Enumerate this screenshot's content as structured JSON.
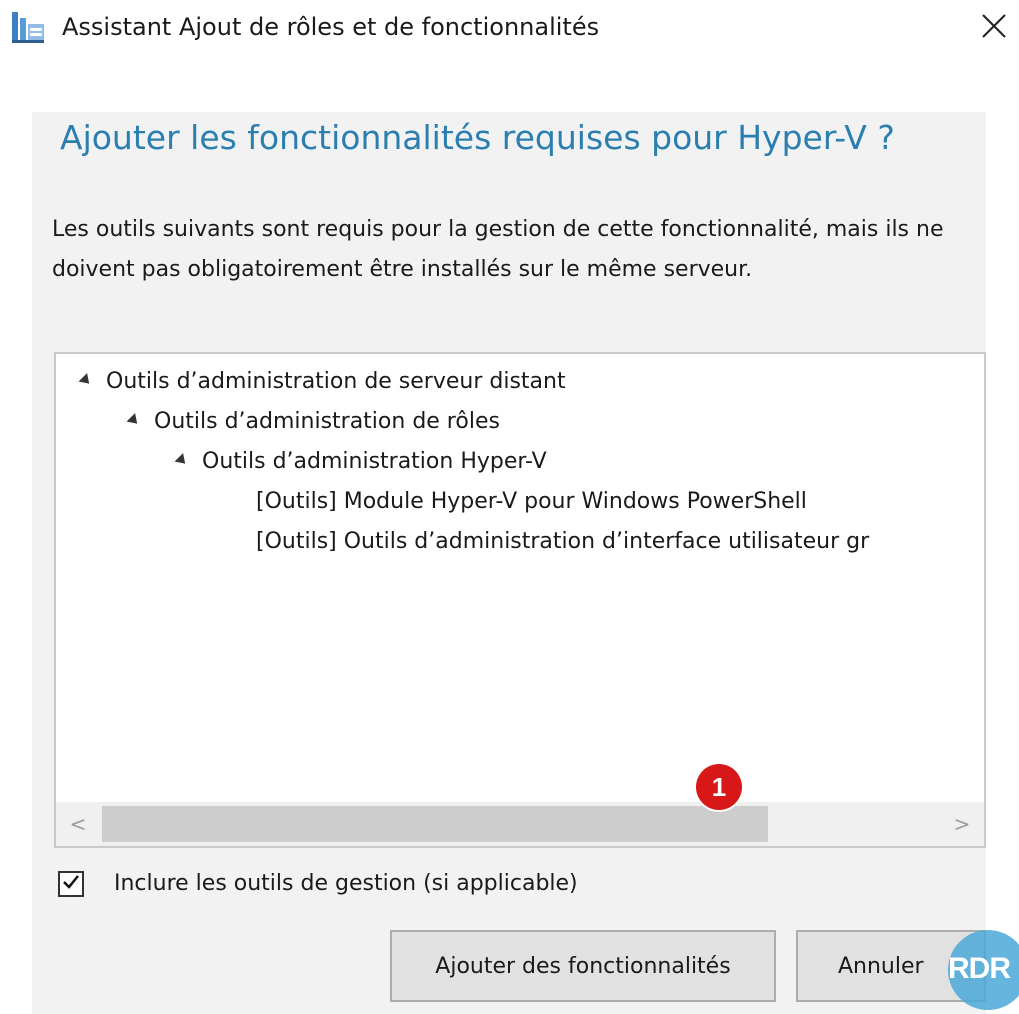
{
  "window": {
    "title": "Assistant Ajout de rôles et de fonctionnalités",
    "close_icon": "close-icon",
    "app_icon": "server-manager-icon"
  },
  "dialog": {
    "heading": "Ajouter les fonctionnalités requises pour Hyper-V ?",
    "description": "Les outils suivants sont requis pour la gestion de cette fonctionnalité, mais ils ne doivent pas obligatoirement être installés sur le même serveur."
  },
  "tree": {
    "items": [
      {
        "label": "Outils d’administration de serveur distant",
        "level": 0,
        "expanded": true
      },
      {
        "label": "Outils d’administration de rôles",
        "level": 1,
        "expanded": true
      },
      {
        "label": "Outils d’administration Hyper-V",
        "level": 2,
        "expanded": true
      },
      {
        "label": "[Outils] Module Hyper-V pour Windows PowerShell",
        "level": 3
      },
      {
        "label": "[Outils] Outils d’administration d’interface utilisateur gr",
        "level": 3
      }
    ],
    "scroll_left": "<",
    "scroll_right": ">"
  },
  "options": {
    "include_tools_label": "Inclure les outils de gestion (si applicable)",
    "include_tools_checked": true
  },
  "buttons": {
    "add_label": "Ajouter des fonctionnalités",
    "cancel_label": "Annuler"
  },
  "annotation": {
    "step_number": "1",
    "color": "#d81818"
  },
  "watermark": {
    "text": "RDR"
  },
  "colors": {
    "heading": "#2b7fb0",
    "panel_bg": "#f2f2f2",
    "button_bg": "#e1e1e1"
  }
}
